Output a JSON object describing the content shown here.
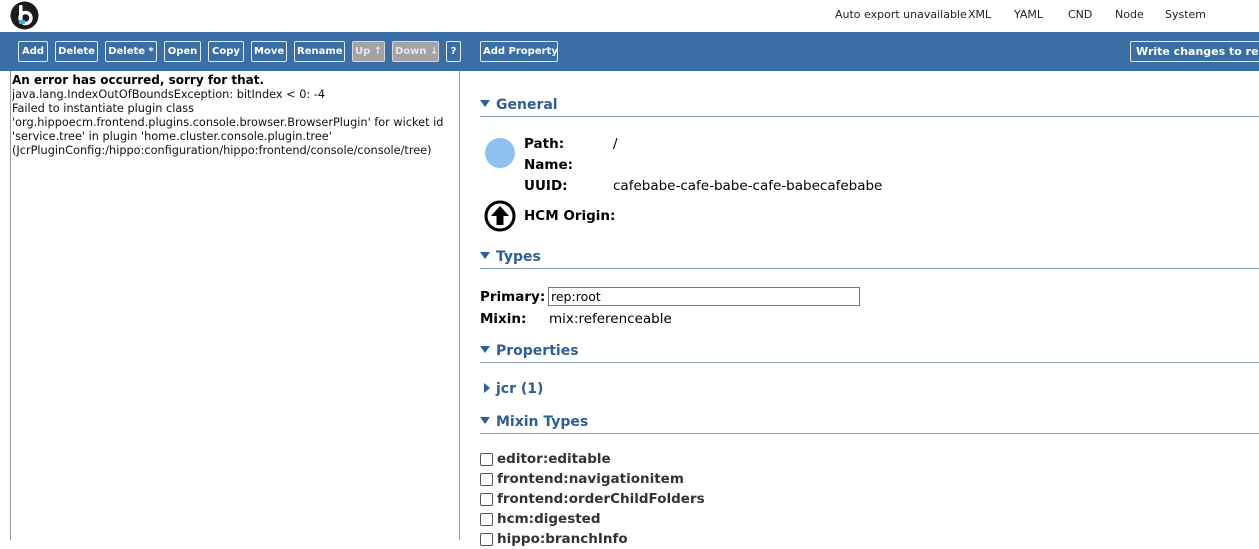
{
  "header": {
    "logo_icon": "hippo-logo-icon",
    "menu": [
      "Auto export unavailable",
      "XML",
      "YAML",
      "CND",
      "Node",
      "System"
    ]
  },
  "toolbar": {
    "buttons": [
      "Add",
      "Delete",
      "Delete *",
      "Open",
      "Copy",
      "Move",
      "Rename",
      "Up ↑",
      "Down ↓",
      "?",
      "Add Property"
    ],
    "write_label": "Write changes to repo",
    "accent_color": "#3a6ea5",
    "disabled_color": "#a3a3a3"
  },
  "error": {
    "title": "An error has occurred, sorry for that.",
    "lines": [
      "java.lang.IndexOutOfBoundsException: bitIndex < 0: -4",
      "Failed to instantiate plugin class",
      "'org.hippoecm.frontend.plugins.console.browser.BrowserPlugin' for wicket id",
      "'service.tree' in plugin 'home.cluster.console.plugin.tree'",
      "(JcrPluginConfig:/hippo:configuration/hippo:frontend/console/console/tree)"
    ]
  },
  "general": {
    "title": "General",
    "path_label": "Path:",
    "path_value": "/",
    "name_label": "Name:",
    "name_value": "",
    "uuid_label": "UUID:",
    "uuid_value": "cafebabe-cafe-babe-cafe-babecafebabe",
    "origin_label": "HCM Origin:",
    "node_icon": "node-circle-icon",
    "origin_icon": "arrow-up-circle-icon",
    "node_color": "#8ec3f0"
  },
  "types": {
    "title": "Types",
    "primary_label": "Primary:",
    "primary_value": "rep:root",
    "mixin_label": "Mixin:",
    "mixin_value": "mix:referenceable"
  },
  "properties": {
    "title": "Properties",
    "group_label": "jcr (1)"
  },
  "mixin_types": {
    "title": "Mixin Types",
    "items": [
      "editor:editable",
      "frontend:navigationitem",
      "frontend:orderChildFolders",
      "hcm:digested",
      "hippo:branchInfo"
    ]
  },
  "colors": {
    "section_title": "#2e5f93"
  }
}
